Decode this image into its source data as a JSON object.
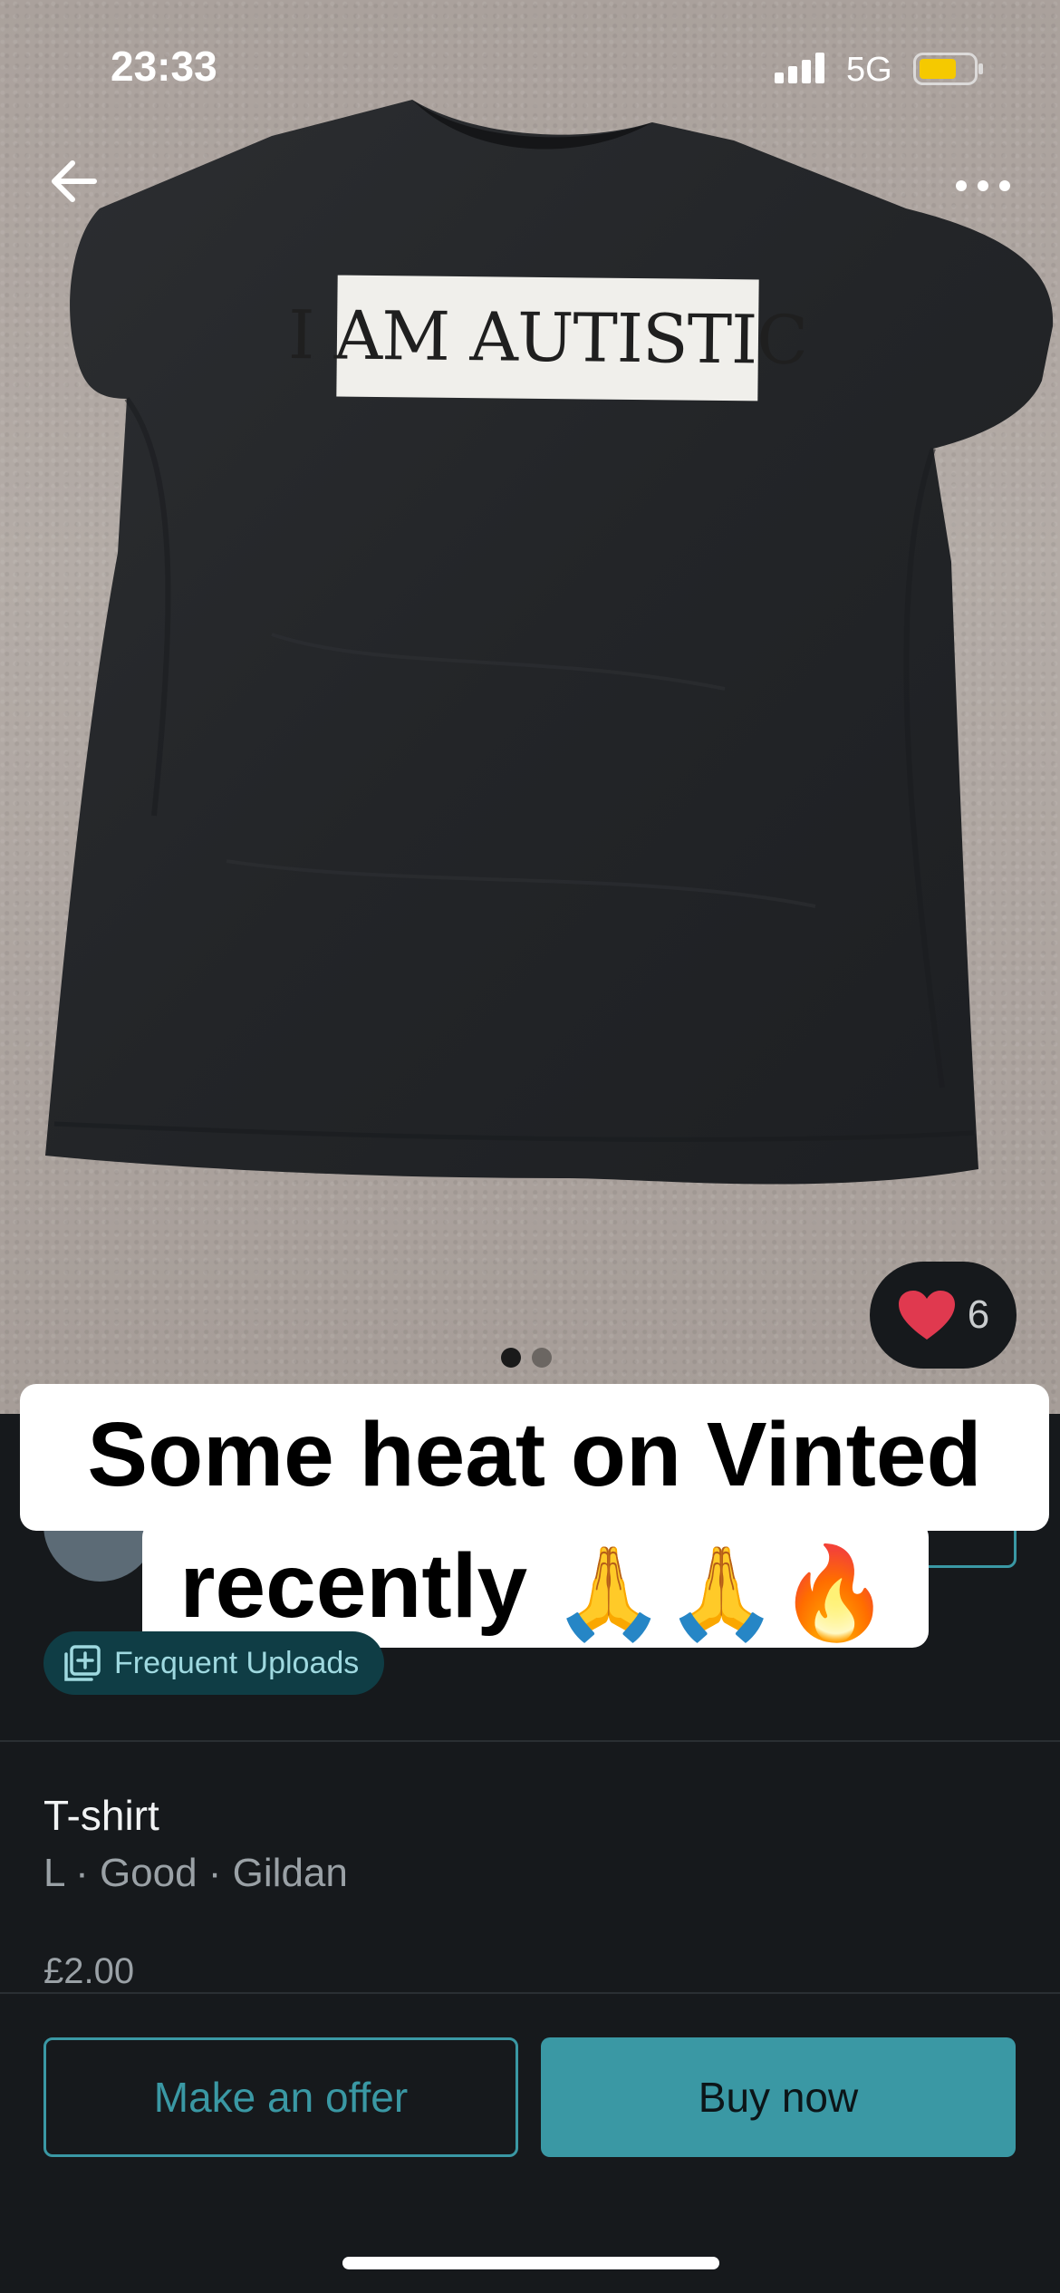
{
  "status_bar": {
    "time": "23:33",
    "network": "5G",
    "signal_icon": "cellular-signal-icon",
    "battery_icon": "battery-icon",
    "battery_color": "#f5c900"
  },
  "nav": {
    "back_icon": "back-arrow-icon",
    "more_icon": "more-options-icon"
  },
  "photo": {
    "shirt_print_text": "I AM AUTISTIC",
    "page_count": 2,
    "active_page": 1
  },
  "likes": {
    "icon": "heart-icon",
    "count": "6",
    "heart_color": "#e0394f"
  },
  "caption": {
    "line1": "Some heat on Vinted",
    "line2": "recently",
    "emojis": [
      "🙏",
      "🙏",
      "🔥"
    ]
  },
  "badge": {
    "icon": "upload-icon",
    "label": "Frequent Uploads"
  },
  "item": {
    "title": "T-shirt",
    "meta": "L · Good · Gildan",
    "price": "£2.00"
  },
  "actions": {
    "offer_label": "Make an offer",
    "buy_label": "Buy now"
  },
  "colors": {
    "accent": "#3a98a4",
    "background": "#16191c",
    "badge_bg": "#0f3d45"
  }
}
